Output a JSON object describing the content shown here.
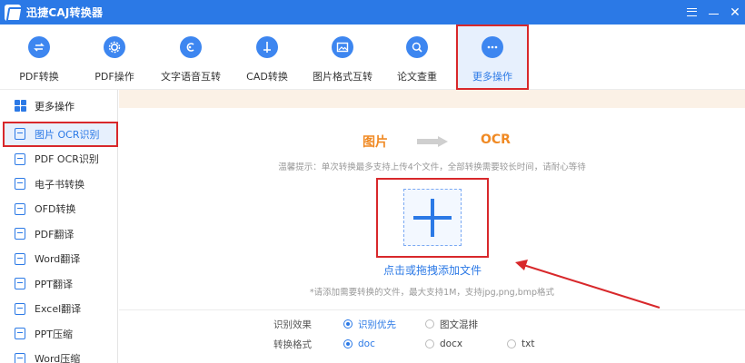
{
  "app": {
    "title": "迅捷CAJ转换器"
  },
  "toolbar": {
    "items": [
      {
        "label": "PDF转换",
        "icon": "pdf-convert-icon"
      },
      {
        "label": "PDF操作",
        "icon": "gear-icon"
      },
      {
        "label": "文字语音互转",
        "icon": "text-speech-icon"
      },
      {
        "label": "CAD转换",
        "icon": "cad-icon"
      },
      {
        "label": "图片格式互转",
        "icon": "image-icon"
      },
      {
        "label": "论文查重",
        "icon": "paper-check-icon"
      },
      {
        "label": "更多操作",
        "icon": "more-dots-icon"
      }
    ],
    "active": "更多操作"
  },
  "sidebar": {
    "header": "更多操作",
    "items": [
      {
        "label": "图片 OCR识别"
      },
      {
        "label": "PDF OCR识别"
      },
      {
        "label": "电子书转换"
      },
      {
        "label": "OFD转换"
      },
      {
        "label": "PDF翻译"
      },
      {
        "label": "Word翻译"
      },
      {
        "label": "PPT翻译"
      },
      {
        "label": "Excel翻译"
      },
      {
        "label": "PPT压缩"
      },
      {
        "label": "Word压缩"
      }
    ],
    "active": "图片 OCR识别"
  },
  "main": {
    "from": "图片",
    "to": "OCR",
    "tip": "温馨提示：单次转换最多支持上传4个文件，全部转换需要较长时间，请耐心等待",
    "upload_link": "点击或拖拽添加文件",
    "formats": "*请添加需要转换的文件，最大支持1M，支持jpg,png,bmp格式",
    "options": {
      "effect": {
        "label": "识别效果",
        "choices": [
          "识别优先",
          "图文混排"
        ],
        "selected": "识别优先"
      },
      "format": {
        "label": "转换格式",
        "choices": [
          "doc",
          "docx",
          "txt"
        ],
        "selected": "doc"
      }
    }
  },
  "colors": {
    "accent": "#2b79e6",
    "highlight": "#d8282b",
    "orange": "#f08a24"
  }
}
